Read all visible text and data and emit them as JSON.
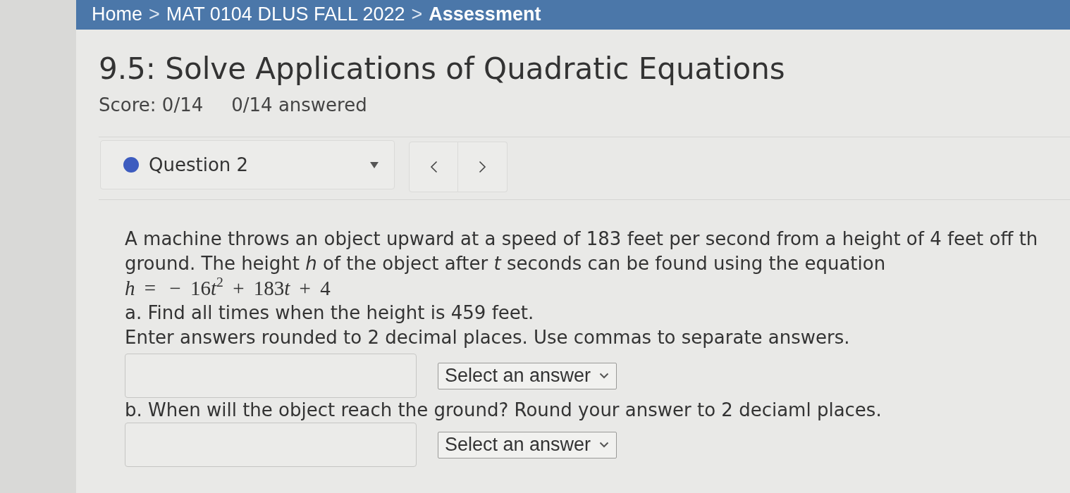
{
  "breadcrumb": [
    {
      "kind": "link",
      "label": "Home"
    },
    {
      "kind": "separator",
      "label": ">"
    },
    {
      "kind": "link",
      "label": "MAT 0104 DLUS FALL 2022"
    },
    {
      "kind": "separator",
      "label": ">"
    },
    {
      "kind": "current",
      "label": "Assessment"
    }
  ],
  "assessment": {
    "title": "9.5: Solve Applications of Quadratic Equations",
    "score": "Score: 0/14",
    "answered": "0/14 answered"
  },
  "question_selector": {
    "label": "Question 2"
  },
  "problem": {
    "lines": [
      "A machine throws an object upward at a speed of 183 feet per second from a height of 4 feet off th",
      "ground. The height *h* of the object after *t* seconds can be found using the equation"
    ],
    "equation": [
      {
        "kind": "variable",
        "text": "h"
      },
      {
        "kind": "operator",
        "text": "="
      },
      {
        "kind": "operator",
        "text": "−"
      },
      {
        "kind": "number",
        "text": "16"
      },
      {
        "kind": "variable",
        "text": "t"
      },
      {
        "kind": "exponent",
        "text": "2"
      },
      {
        "kind": "operator",
        "text": "+"
      },
      {
        "kind": "number",
        "text": "183"
      },
      {
        "kind": "variable",
        "text": "t"
      },
      {
        "kind": "operator",
        "text": "+"
      },
      {
        "kind": "number",
        "text": "4"
      }
    ],
    "parts": [
      {
        "lines": [
          "a. Find all times when the height is 459 feet.",
          "Enter answers rounded to 2 decimal places. Use commas to separate answers."
        ],
        "select": "Select an answer"
      },
      {
        "lines": [
          "b. When will the object reach the ground? Round your answer to 2 deciaml places."
        ],
        "select": "Select an answer"
      }
    ]
  }
}
